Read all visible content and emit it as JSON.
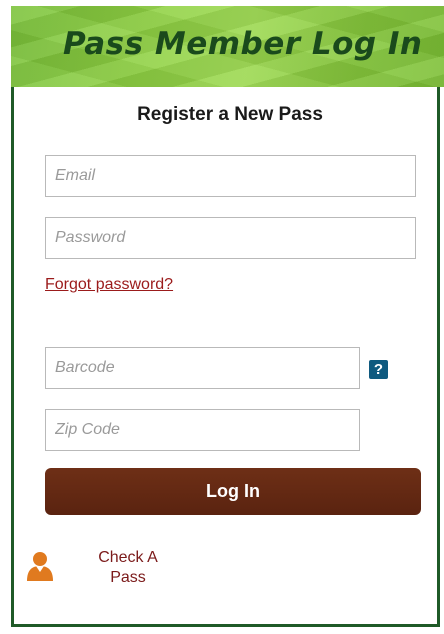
{
  "header": {
    "title": "Pass Member Log In"
  },
  "form": {
    "heading": "Register a New Pass",
    "email_placeholder": "Email",
    "password_placeholder": "Password",
    "forgot_label": "Forgot password?",
    "barcode_placeholder": "Barcode",
    "help_label": "?",
    "zip_placeholder": "Zip Code",
    "login_label": "Log In"
  },
  "footer": {
    "check_pass_label": "Check A Pass"
  },
  "colors": {
    "header_green": "#8fd143",
    "title_green": "#1a4a1c",
    "border_green": "#1f5a27",
    "button_brown": "#5e2612",
    "link_red": "#9b1b1b",
    "help_blue": "#0f5a7f",
    "icon_orange": "#e07a1f"
  },
  "icons": {
    "help": "question-icon",
    "check_pass": "user-icon"
  }
}
